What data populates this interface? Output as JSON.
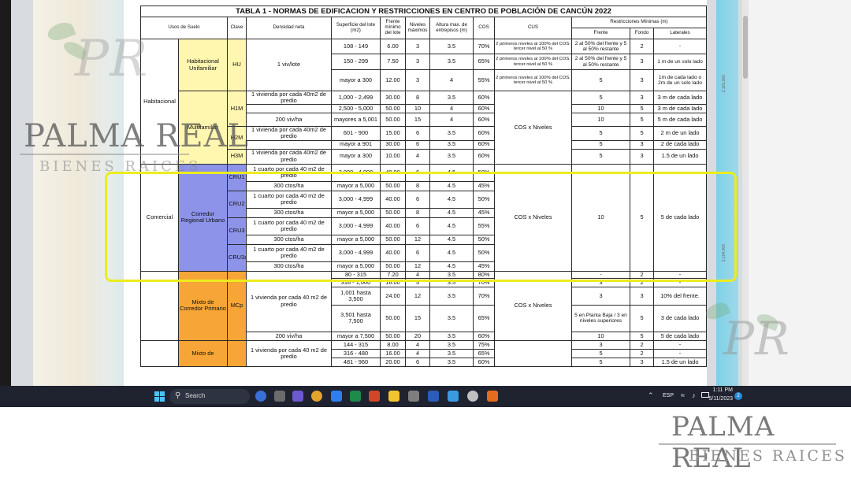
{
  "table": {
    "title": "TABLA 1 - NORMAS DE EDIFICACION Y RESTRICCIONES EN CENTRO DE POBLACIÓN DE CANCÚN 2022",
    "headers": {
      "uso": "Usos de Suelo",
      "clave": "Clave",
      "densidad": "Densidad neta",
      "superficie": "Superficie del lote (m2)",
      "frente": "Frente mínimo del lote",
      "niveles": "Niveles máximos",
      "altura": "Altura max. de entrepisos (m)",
      "cos": "COS",
      "cus": "CUS",
      "restricciones": "Restricciones Mínimas (m)",
      "r_frente": "Frente",
      "r_fondo": "Fondo",
      "r_laterales": "Laterales"
    },
    "groups": {
      "habitacional": "Habitacional",
      "hab_unifamiliar": "Habitacional Unifamiliar",
      "multifamiliar": "Multifamiliar",
      "comercial": "Comercial",
      "corredor": "Corredor Regional Urbano",
      "mixto_primario": "Mixto de Corredor Primario",
      "mixto_de": "Mixto de"
    },
    "keys": {
      "hu": "HU",
      "h1m": "H1M",
      "h2m": "H2M",
      "h3m": "H3M",
      "cru1": "CRU1",
      "cru2": "CRU2",
      "cru3": "CRU3",
      "cru3a": "CRU3a",
      "mcp": "MCp"
    },
    "common": {
      "cus_levels": "COS x Niveles",
      "hu_density": "1 viv/lote",
      "cus_hu": "2 primeros niveles al 100% del COS, tercer nivel al 50 %",
      "viv_40": "1 vivienda por cada 40m2 de predio",
      "viv_40_sp": "1 vivienda por cada 40 m2 de predio",
      "cuarto_40": "1 cuarto por cada 40 m2 de predio",
      "ctos_300": "300 ctos/ha",
      "viv_200": "200 viv/ha",
      "cru_frente": "10",
      "cru_fondo": "5",
      "cru_lat": "5 de cada lado"
    },
    "hu_rows": [
      {
        "sup": "108 - 149",
        "fr": "6.00",
        "niv": "3",
        "alt": "3.5",
        "cos": "70%",
        "rf": "2 al 50% del frente y 5 al 50% restante",
        "fo": "2",
        "lat": "-"
      },
      {
        "sup": "150 - 299",
        "fr": "7.50",
        "niv": "3",
        "alt": "3.5",
        "cos": "65%",
        "rf": "2 al 50% del frente y 5 al 50% restante",
        "fo": "3",
        "lat": "1 m de un solo lado"
      },
      {
        "sup": "mayor a 300",
        "fr": "12.00",
        "niv": "3",
        "alt": "4",
        "cos": "55%",
        "rf": "5",
        "fo": "3",
        "lat": "1m de cada lado o 2m de un solo lado"
      }
    ],
    "multi_rows": [
      {
        "den": "1 vivienda por cada 40m2 de predio",
        "sup": "1,000 - 2,499",
        "fr": "30.00",
        "niv": "8",
        "alt": "3.5",
        "cos": "60%",
        "rf": "5",
        "fo": "3",
        "lat": "3 m de cada lado"
      },
      {
        "den": "",
        "sup": "2,500 - 5,000",
        "fr": "50.00",
        "niv": "10",
        "alt": "4",
        "cos": "60%",
        "rf": "10",
        "fo": "5",
        "lat": "3 m de cada lado"
      },
      {
        "den": "200 viv/ha",
        "sup": "mayores a 5,001",
        "fr": "50.00",
        "niv": "15",
        "alt": "4",
        "cos": "60%",
        "rf": "10",
        "fo": "5",
        "lat": "5 m de cada lado"
      },
      {
        "den": "1 vivienda por cada 40m2 de predio",
        "sup": "601 - 900",
        "fr": "15.00",
        "niv": "6",
        "alt": "3.5",
        "cos": "60%",
        "rf": "5",
        "fo": "5",
        "lat": "2 m de un lado"
      },
      {
        "den": "",
        "sup": "mayor a 901",
        "fr": "30.00",
        "niv": "6",
        "alt": "3.5",
        "cos": "60%",
        "rf": "5",
        "fo": "3",
        "lat": "2 de cada lado"
      },
      {
        "den": "1 vivienda por cada 40m2 de predio",
        "sup": "mayor a 300",
        "fr": "10.00",
        "niv": "4",
        "alt": "3.5",
        "cos": "60%",
        "rf": "5",
        "fo": "3",
        "lat": "1.5 de un lado"
      }
    ],
    "cru_rows": [
      {
        "sup": "3,000 - 4,999",
        "fr": "40.00",
        "niv": "6",
        "alt": "4.5",
        "cos": "50%"
      },
      {
        "sup": "mayor a 5,000",
        "fr": "50.00",
        "niv": "8",
        "alt": "4.5",
        "cos": "45%"
      },
      {
        "sup": "3,000 - 4,999",
        "fr": "40.00",
        "niv": "6",
        "alt": "4.5",
        "cos": "50%"
      },
      {
        "sup": "mayor a 5,000",
        "fr": "50.00",
        "niv": "8",
        "alt": "4.5",
        "cos": "45%"
      },
      {
        "sup": "3,000 - 4,999",
        "fr": "40.00",
        "niv": "6",
        "alt": "4.5",
        "cos": "55%"
      },
      {
        "sup": "mayor a 5,000",
        "fr": "50.00",
        "niv": "12",
        "alt": "4.5",
        "cos": "50%"
      },
      {
        "sup": "3,000 - 4,999",
        "fr": "40.00",
        "niv": "6",
        "alt": "4.5",
        "cos": "50%"
      },
      {
        "sup": "mayor a 5,000",
        "fr": "50.00",
        "niv": "12",
        "alt": "4.5",
        "cos": "45%"
      }
    ],
    "mcp_rows": [
      {
        "sup": "80 - 315",
        "fr": "7.20",
        "niv": "4",
        "alt": "3.5",
        "cos": "80%",
        "rf": "-",
        "fo": "2",
        "lat": "-"
      },
      {
        "sup": "316 - 1,000",
        "fr": "16.00",
        "niv": "5",
        "alt": "3.5",
        "cos": "70%",
        "rf": "3",
        "fo": "2",
        "lat": "-"
      },
      {
        "sup": "1,001 hasta 3,500",
        "fr": "24.00",
        "niv": "12",
        "alt": "3.5",
        "cos": "70%",
        "rf": "3",
        "fo": "3",
        "lat": "10% del frente."
      },
      {
        "sup": "3,501 hasta 7,500",
        "fr": "50.00",
        "niv": "15",
        "alt": "3.5",
        "cos": "65%",
        "rf": "5 en Planta Baja / 3 en niveles superiores",
        "fo": "5",
        "lat": "3 de cada lado"
      },
      {
        "sup": "mayor a 7,500",
        "fr": "50.00",
        "niv": "20",
        "alt": "3.5",
        "cos": "60%",
        "rf": "10",
        "fo": "5",
        "lat": "5 de cada lado"
      }
    ],
    "mixto_rows": [
      {
        "sup": "144 - 315",
        "fr": "8.00",
        "niv": "4",
        "alt": "3.5",
        "cos": "75%",
        "rf": "3",
        "fo": "2",
        "lat": "-"
      },
      {
        "sup": "316 - 480",
        "fr": "16.00",
        "niv": "4",
        "alt": "3.5",
        "cos": "65%",
        "rf": "5",
        "fo": "2",
        "lat": "-"
      },
      {
        "sup": "481 - 960",
        "fr": "20.00",
        "niv": "6",
        "alt": "3.5",
        "cos": "60%",
        "rf": "5",
        "fo": "3",
        "lat": "1.5 de un lado"
      }
    ]
  },
  "watermark": {
    "brand": "PALMA REAL",
    "sub": "BIENES RAICES",
    "mono": "PR"
  },
  "side_labels": {
    "top": "2,101,000",
    "bottom": "2,104,000"
  },
  "taskbar": {
    "search_label": "Search",
    "lang": "ESP",
    "time": "1:11 PM",
    "date": "5/11/2023",
    "badge": "2"
  },
  "colors": {
    "highlight": "#ecec1e",
    "hab_unifamiliar": "#fff6b0",
    "corredor": "#8c93e8",
    "mixto": "#f6a536",
    "taskbar": "#1f2330"
  }
}
